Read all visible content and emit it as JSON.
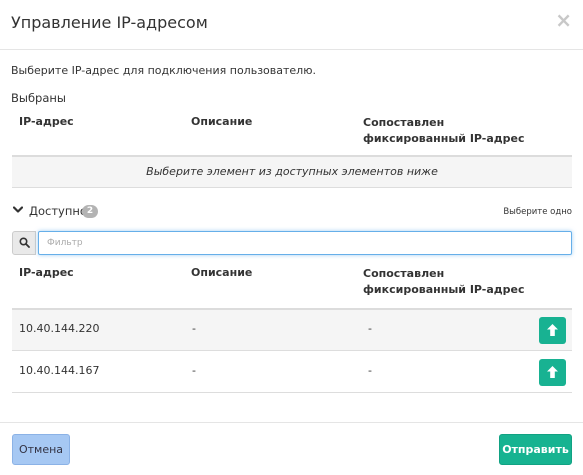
{
  "dialog": {
    "title": "Управление IP-адресом",
    "close_label": "×"
  },
  "intro_text": "Выберите IP-адрес для подключения пользователю.",
  "selected": {
    "title": "Выбраны",
    "columns": [
      "IP-адрес",
      "Описание",
      "Сопоставлен фиксированный IP-адрес"
    ],
    "empty_message": "Выберите элемент из доступных элементов ниже"
  },
  "available": {
    "title": "Доступно",
    "count": "2",
    "hint": "Выберите одно",
    "filter_placeholder": "Фильтр",
    "columns": [
      "IP-адрес",
      "Описание",
      "Сопоставлен фиксированный IP-адрес"
    ],
    "rows": [
      {
        "ip": "10.40.144.220",
        "description": "-",
        "fixed_ip": "-"
      },
      {
        "ip": "10.40.144.167",
        "description": "-",
        "fixed_ip": "-"
      }
    ]
  },
  "footer": {
    "cancel_label": "Отмена",
    "submit_label": "Отправить"
  },
  "colors": {
    "accent_green": "#18b292",
    "cancel_blue": "#a6c8f3",
    "focus_border": "#66afe9"
  },
  "icons": {
    "close": "close-icon",
    "chevron": "chevron-down-icon",
    "search": "search-icon",
    "upload": "arrow-up-icon"
  }
}
